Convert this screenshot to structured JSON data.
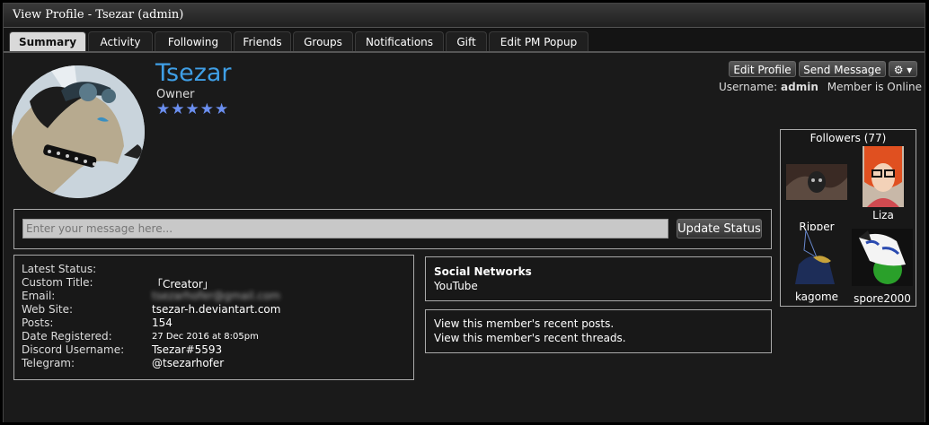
{
  "window": {
    "title": "View Profile - Tsezar (admin)"
  },
  "tabs": [
    {
      "label": "Summary",
      "active": true
    },
    {
      "label": "Activity"
    },
    {
      "label": "Following"
    },
    {
      "label": "Friends"
    },
    {
      "label": "Groups"
    },
    {
      "label": "Notifications"
    },
    {
      "label": "Gift"
    },
    {
      "label": "Edit PM Popup"
    }
  ],
  "profile": {
    "name": "Tsezar",
    "role": "Owner",
    "stars": "★★★★★",
    "username_label": "Username:",
    "username": "admin",
    "online_status": "Member is Online"
  },
  "actions": {
    "edit_profile": "Edit Profile",
    "send_message": "Send Message",
    "gear_icon": "gear-icon"
  },
  "status": {
    "placeholder": "Enter your message here...",
    "update_label": "Update Status"
  },
  "info": {
    "rows": [
      {
        "label": "Latest Status:",
        "value": ""
      },
      {
        "label": "Custom Title:",
        "value": "「Creator」"
      },
      {
        "label": "Email:",
        "value": "tsezarhofer@gmail.com"
      },
      {
        "label": "Web Site:",
        "value": "tsezar-h.deviantart.com"
      },
      {
        "label": "Posts:",
        "value": "154"
      },
      {
        "label": "Date Registered:",
        "value": "27 Dec 2016 at 8:05pm"
      },
      {
        "label": "Discord Username:",
        "value": "Tsezar#5593"
      },
      {
        "label": "Telegram:",
        "value": "@tsezarhofer"
      }
    ]
  },
  "social": {
    "title": "Social Networks",
    "link": "YouTube"
  },
  "recent": {
    "posts": "View this member's recent posts.",
    "threads": "View this member's recent threads."
  },
  "followers": {
    "title": "Followers (77)",
    "items": [
      {
        "name": "Ripper"
      },
      {
        "name": "Liza"
      },
      {
        "name": "kagome"
      },
      {
        "name": "spore2000"
      }
    ]
  }
}
